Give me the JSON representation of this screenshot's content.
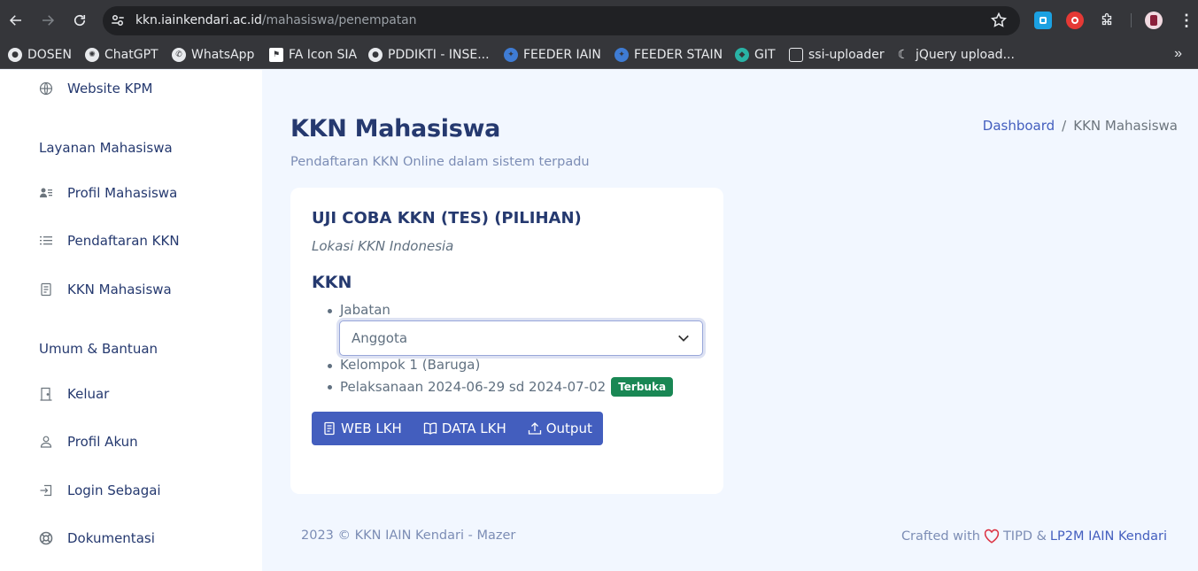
{
  "browser": {
    "url_host": "kkn.iainkendari.ac.id",
    "url_path": "/mahasiswa/penempatan",
    "bookmarks": [
      {
        "label": "DOSEN",
        "icon": "globe-icon"
      },
      {
        "label": "ChatGPT",
        "icon": "chatgpt-icon"
      },
      {
        "label": "WhatsApp",
        "icon": "whatsapp-icon"
      },
      {
        "label": "FA Icon SIA",
        "icon": "flag-icon"
      },
      {
        "label": "PDDIKTI - INSE...",
        "icon": "globe-icon"
      },
      {
        "label": "FEEDER IAIN",
        "icon": "feeder-icon"
      },
      {
        "label": "FEEDER STAIN",
        "icon": "feeder-icon"
      },
      {
        "label": "GIT",
        "icon": "git-icon"
      },
      {
        "label": "ssi-uploader",
        "icon": "page-icon"
      },
      {
        "label": "jQuery upload...",
        "icon": "jquery-icon"
      }
    ]
  },
  "sidebar": {
    "top_item": "Website KPM",
    "section1_title": "Layanan Mahasiswa",
    "section1_items": [
      "Profil Mahasiswa",
      "Pendaftaran KKN",
      "KKN Mahasiswa"
    ],
    "section2_title": "Umum & Bantuan",
    "section2_items": [
      "Keluar",
      "Profil Akun",
      "Login Sebagai",
      "Dokumentasi"
    ]
  },
  "page": {
    "title": "KKN Mahasiswa",
    "subtitle": "Pendaftaran KKN Online dalam sistem terpadu",
    "breadcrumb_home": "Dashboard",
    "breadcrumb_sep": "/",
    "breadcrumb_current": "KKN Mahasiswa"
  },
  "card": {
    "title": "UJI COBA KKN (TES) (PILIHAN)",
    "location": "Lokasi KKN Indonesia",
    "heading": "KKN",
    "jabatan_label": "Jabatan",
    "jabatan_value": "Anggota",
    "kelompok": "Kelompok 1 (Baruga)",
    "pelaksanaan": "Pelaksanaan 2024-06-29 sd 2024-07-02",
    "status_badge": "Terbuka",
    "buttons": [
      "WEB LKH",
      "DATA LKH",
      "Output"
    ]
  },
  "footer": {
    "left": "2023 © KKN IAIN Kendari - Mazer",
    "crafted": "Crafted with",
    "by": "TIPD &",
    "link": "LP2M IAIN Kendari"
  },
  "colors": {
    "primary": "#435ebe",
    "title": "#25396f",
    "badge_green": "#198754",
    "heart": "#dc3545"
  }
}
